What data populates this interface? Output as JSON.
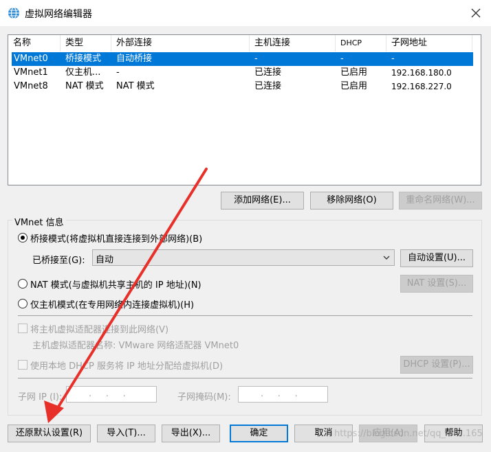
{
  "window": {
    "title": "虚拟网络编辑器",
    "icon": "globe-icon"
  },
  "table": {
    "headers": [
      "名称",
      "类型",
      "外部连接",
      "主机连接",
      "DHCP",
      "子网地址"
    ],
    "rows": [
      {
        "name": "VMnet0",
        "type": "桥接模式",
        "external": "自动桥接",
        "host": "-",
        "dhcp": "-",
        "subnet": "-",
        "selected": true
      },
      {
        "name": "VMnet1",
        "type": "仅主机...",
        "external": "-",
        "host": "已连接",
        "dhcp": "已启用",
        "subnet": "192.168.180.0",
        "selected": false
      },
      {
        "name": "VMnet8",
        "type": "NAT 模式",
        "external": "NAT 模式",
        "host": "已连接",
        "dhcp": "已启用",
        "subnet": "192.168.227.0",
        "selected": false
      }
    ]
  },
  "list_buttons": {
    "add": "添加网络(E)...",
    "remove": "移除网络(O)",
    "rename": "重命名网络(W)..."
  },
  "vmnet_info": {
    "group_label": "VMnet 信息",
    "bridged_radio": "桥接模式(将虚拟机直接连接到外部网络)(B)",
    "bridged_to_label": "已桥接至(G):",
    "bridged_to_value": "自动",
    "auto_settings_button": "自动设置(U)...",
    "nat_radio": "NAT 模式(与虚拟机共享主机的 IP 地址)(N)",
    "nat_settings_button": "NAT 设置(S)...",
    "hostonly_radio": "仅主机模式(在专用网络内连接虚拟机)(H)",
    "connect_adapter_check": "将主机虚拟适配器连接到此网络(V)",
    "adapter_name_label": "主机虚拟适配器名称: VMware 网络适配器 VMnet0",
    "dhcp_check": "使用本地 DHCP 服务将 IP 地址分配给虚拟机(D)",
    "dhcp_settings_button": "DHCP 设置(P)...",
    "subnet_ip_label": "子网 IP (I):",
    "subnet_ip_value": ".     .     .",
    "subnet_mask_label": "子网掩码(M):",
    "subnet_mask_value": ".     .     ."
  },
  "footer": {
    "restore": "还原默认设置(R)",
    "import": "导入(T)...",
    "export": "导出(X)...",
    "ok": "确定",
    "cancel": "取消",
    "apply": "应用(A)",
    "help": "帮助"
  },
  "watermark": "https://blog.csdn.net/qq_44...165",
  "colors": {
    "selection": "#0078d7",
    "arrow": "#e8302a"
  }
}
